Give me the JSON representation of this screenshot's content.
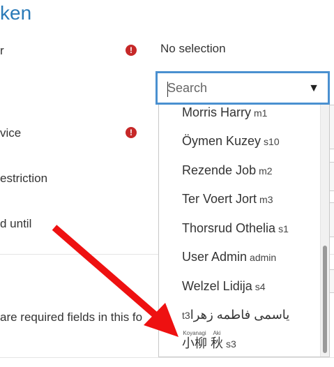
{
  "page": {
    "title": "ken"
  },
  "form": {
    "labels": [
      "r",
      "vice",
      "estriction",
      "d until"
    ],
    "no_selection": "No selection",
    "required_note": "are required fields in this fo"
  },
  "search": {
    "placeholder": "Search",
    "arrow": "▼"
  },
  "options": [
    {
      "name": "Morris Harry",
      "code": "m1"
    },
    {
      "name": "Öymen Kuzey",
      "code": "s10"
    },
    {
      "name": "Rezende Job",
      "code": "m2"
    },
    {
      "name": "Ter Voert Jort",
      "code": "m3"
    },
    {
      "name": "Thorsrud Othelia",
      "code": "s1"
    },
    {
      "name": "User Admin",
      "code": "admin"
    },
    {
      "name": "Welzel Lidija",
      "code": "s4"
    },
    {
      "name": "یاسمی فاطمه زهرا",
      "code": "t3"
    },
    {
      "family": "小柳",
      "family_reading": "Koyanagi",
      "given": "秋",
      "given_reading": "Aki",
      "code": "s3"
    }
  ],
  "colors": {
    "title": "#2a7ab8",
    "focus_border": "#4a90d0",
    "required": "#c62828",
    "annotation_arrow": "#ee1111"
  }
}
